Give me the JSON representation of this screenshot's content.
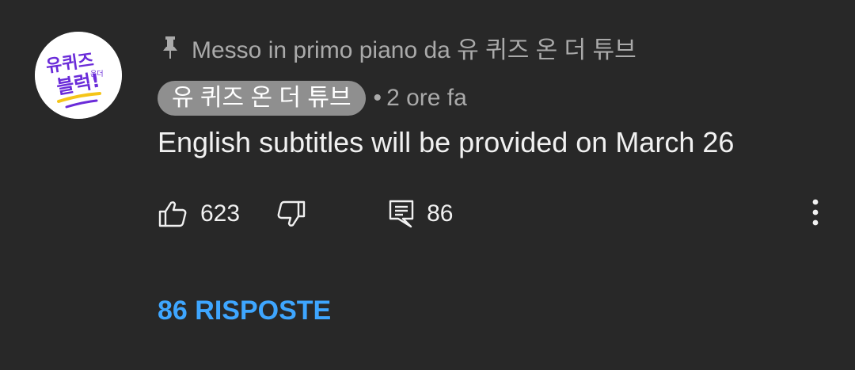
{
  "comment": {
    "pinned_label": "Messo in primo piano da 유 퀴즈 온 더 튜브",
    "author": "유 퀴즈 온 더 튜브",
    "separator": "•",
    "time": "2 ore fa",
    "text": "English subtitles will be provided on March 26",
    "avatar_text": {
      "line1": "유퀴즈",
      "small": "온더",
      "line2": "블럭!"
    }
  },
  "actions": {
    "like_count": "623",
    "reply_count": "86"
  },
  "replies": {
    "label": "86 RISPOSTE"
  },
  "icons": {
    "pin": "pin-icon",
    "like": "thumbs-up-icon",
    "dislike": "thumbs-down-icon",
    "reply": "comment-icon",
    "menu": "more-vertical-icon"
  },
  "colors": {
    "background": "#282828",
    "text": "#f1f1f1",
    "secondary_text": "#aaaaaa",
    "author_chip": "#8f8f8f",
    "link": "#3ea6ff",
    "avatar_purple": "#6a2bd9",
    "avatar_yellow": "#f5c518"
  }
}
